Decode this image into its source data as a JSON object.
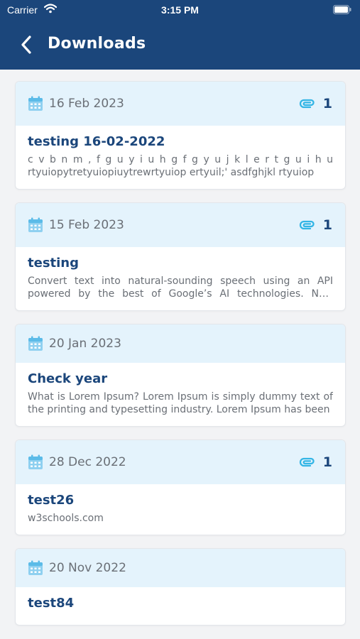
{
  "status": {
    "carrier": "Carrier",
    "time": "3:15 PM"
  },
  "nav": {
    "title": "Downloads"
  },
  "colors": {
    "header": "#1b467b",
    "card_head": "#e4f3fc",
    "accent": "#33b5e5",
    "title": "#1b467b"
  },
  "items": [
    {
      "date": "16 Feb 2023",
      "attachments": "1",
      "title": "testing 16-02-2022",
      "desc": "c v b n m ,   f g u y i u h   g f g y u j k l   e r t g u i h u rtyuiopytretyuiopiuytrewrtyuiop ertyuil;' asdfghjkl rtyuiop"
    },
    {
      "date": "15 Feb 2023",
      "attachments": "1",
      "title": "testing",
      "desc": "Convert text into natural-sounding speech using an API powered by the best of Google’s AI technologies. New customers get credits"
    },
    {
      "date": "20 Jan 2023",
      "attachments": "",
      "title": "Check year",
      "desc": "What is Lorem Ipsum? Lorem Ipsum is simply dummy text of the printing and typesetting industry. Lorem Ipsum has been"
    },
    {
      "date": "28 Dec 2022",
      "attachments": "1",
      "title": "test26",
      "desc": "w3schools.com"
    },
    {
      "date": "20 Nov 2022",
      "attachments": "",
      "title": "test84",
      "desc": ""
    }
  ]
}
